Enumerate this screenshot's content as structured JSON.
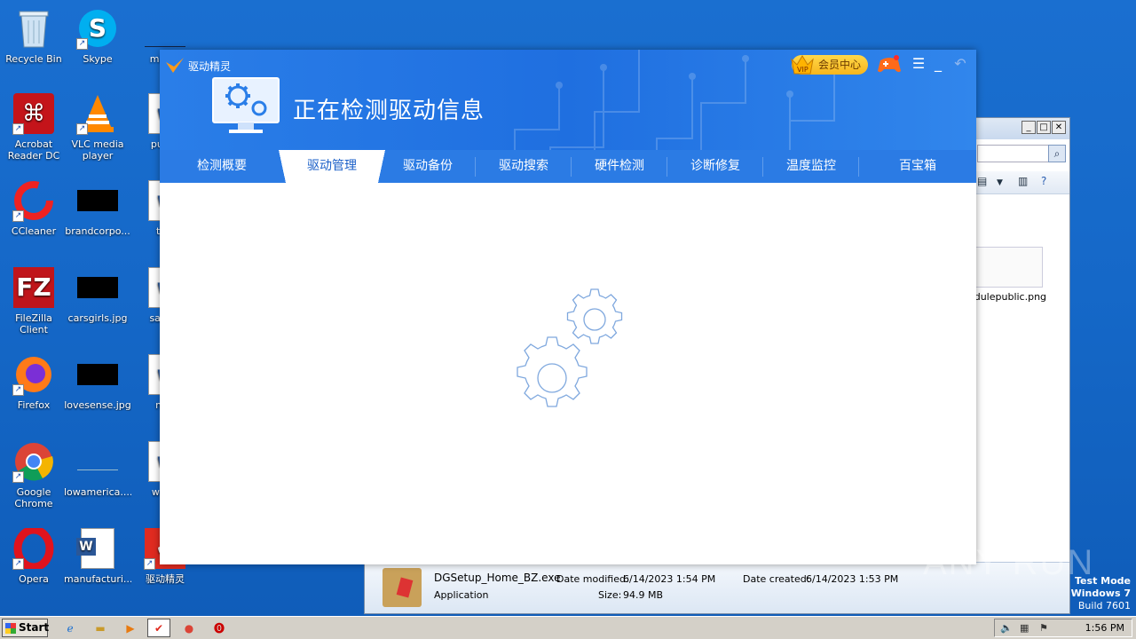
{
  "desktop": {
    "icons": [
      {
        "label": "Recycle Bin"
      },
      {
        "label": "Skype"
      },
      {
        "label": "minim"
      },
      {
        "label": "Acrobat Reader DC"
      },
      {
        "label": "VLC media player"
      },
      {
        "label": "purpo"
      },
      {
        "label": "CCleaner"
      },
      {
        "label": "brandcorpo..."
      },
      {
        "label": "this"
      },
      {
        "label": "FileZilla Client"
      },
      {
        "label": "carsgirls.jpg"
      },
      {
        "label": "saturd"
      },
      {
        "label": "Firefox"
      },
      {
        "label": "lovesense.jpg"
      },
      {
        "label": "met"
      },
      {
        "label": "Google Chrome"
      },
      {
        "label": "lowamerica...."
      },
      {
        "label": "world"
      },
      {
        "label": "Opera"
      },
      {
        "label": "manufacturi..."
      },
      {
        "label": "驱动精灵"
      }
    ]
  },
  "explorer": {
    "thumb_label": "odulepublic.png",
    "file_name": "DGSetup_Home_BZ.exe",
    "file_type": "Application",
    "date_modified_label": "Date modified:",
    "date_modified": "6/14/2023 1:54 PM",
    "size_label": "Size:",
    "size": "94.9 MB",
    "date_created_label": "Date created:",
    "date_created": "6/14/2023 1:53 PM"
  },
  "app": {
    "name": "驱动精灵",
    "header_title": "正在检测驱动信息",
    "vip_label": "会员中心",
    "tabs": [
      {
        "label": "检测概要"
      },
      {
        "label": "驱动管理",
        "active": true
      },
      {
        "label": "驱动备份"
      },
      {
        "label": "驱动搜索"
      },
      {
        "label": "硬件检测"
      },
      {
        "label": "诊断修复"
      },
      {
        "label": "温度监控"
      },
      {
        "label": "百宝箱"
      }
    ],
    "colors": {
      "header": "#2a7ee8",
      "tab_active_text": "#1a5fc8",
      "vip": "#f7b51c"
    }
  },
  "watermark": "ANY RUN",
  "test_mode": {
    "line1": "Test Mode",
    "line2": "Windows 7",
    "line3": "Build 7601"
  },
  "taskbar": {
    "start_label": "Start",
    "clock": "1:56 PM"
  }
}
